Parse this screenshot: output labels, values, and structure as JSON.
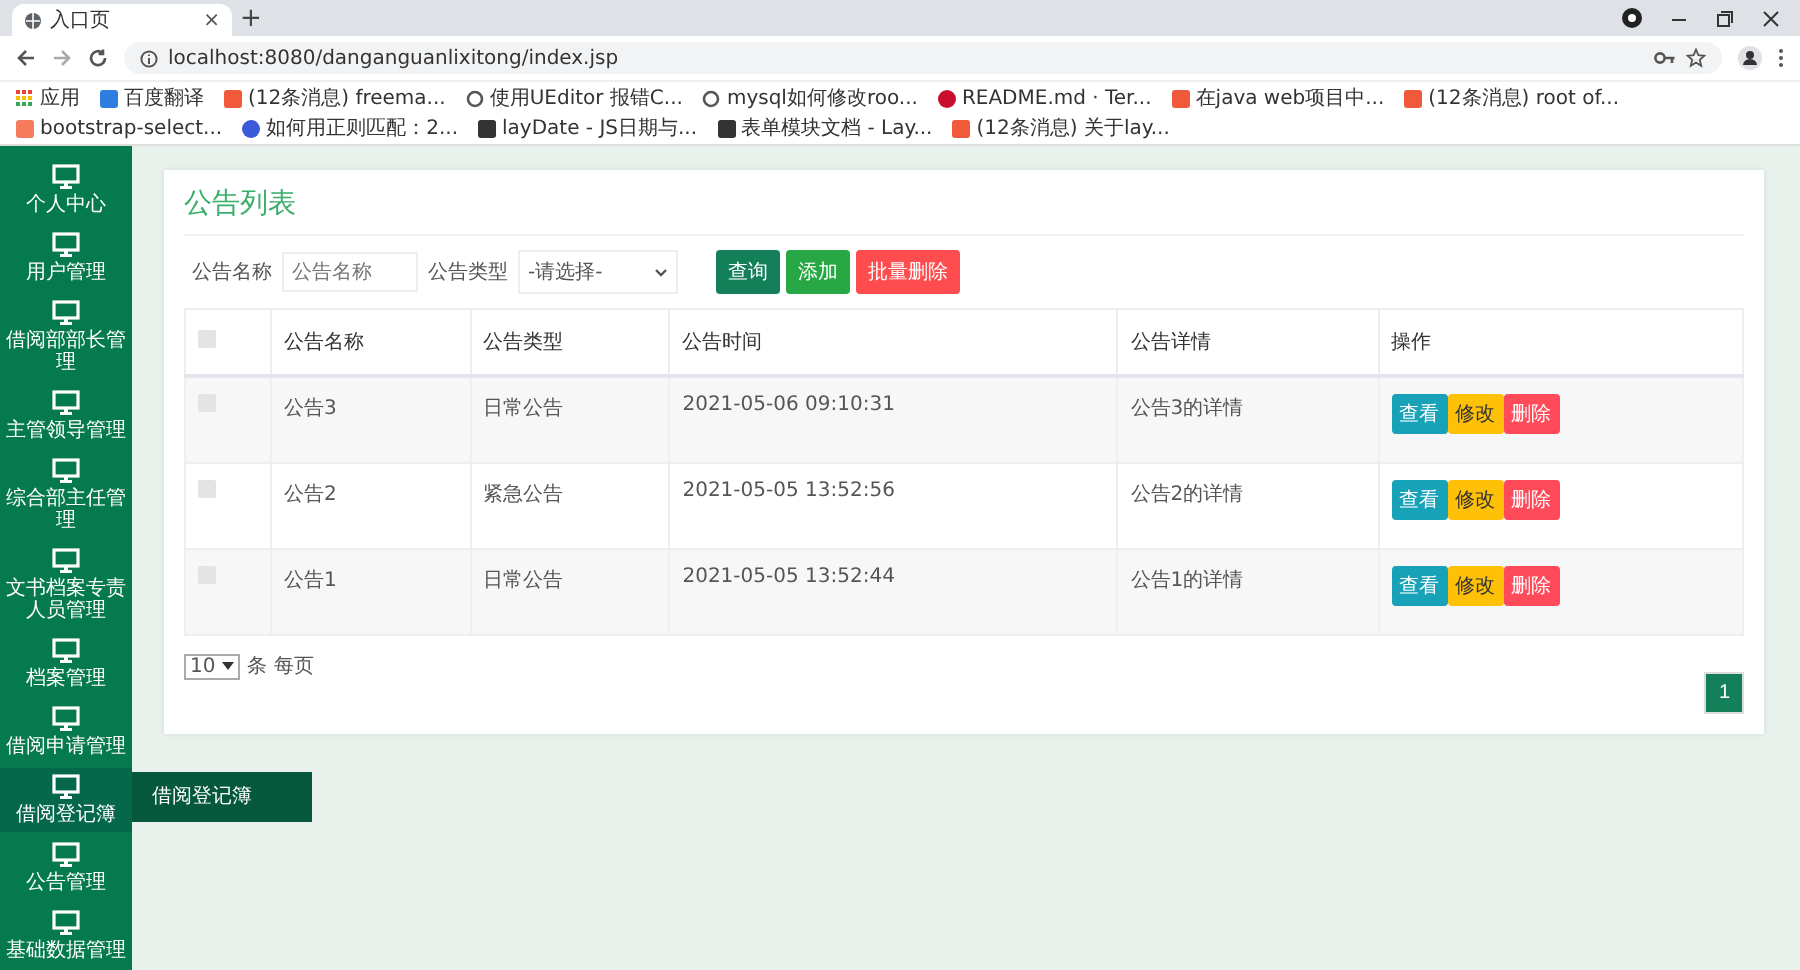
{
  "browser": {
    "tab": {
      "title": "入口页",
      "close": "×"
    },
    "new_tab": "+",
    "url": "localhost:8080/danganguanlixitong/index.jsp",
    "bookmarks": [
      {
        "kind": "apps",
        "label": "应用"
      },
      {
        "kind": "site",
        "color": "#2e7de1",
        "label": "百度翻译"
      },
      {
        "kind": "site",
        "color": "#f05a3a",
        "label": "(12条消息) freema..."
      },
      {
        "kind": "outline",
        "color": "#555555",
        "label": "使用UEditor 报错C..."
      },
      {
        "kind": "outline",
        "color": "#555555",
        "label": "mysql如何修改roo..."
      },
      {
        "kind": "round",
        "color": "#c8102e",
        "label": "README.md · Ter..."
      },
      {
        "kind": "site",
        "color": "#f05a3a",
        "label": "在java web项目中..."
      },
      {
        "kind": "site",
        "color": "#f05a3a",
        "label": "(12条消息) root of..."
      },
      {
        "kind": "site",
        "color": "#f47c5c",
        "label": "bootstrap-select..."
      },
      {
        "kind": "round",
        "color": "#3b5ad9",
        "label": "如何用正则匹配：2..."
      },
      {
        "kind": "site",
        "color": "#333333",
        "label": "layDate - JS日期与..."
      },
      {
        "kind": "site",
        "color": "#333333",
        "label": "表单模块文档 - Lay..."
      },
      {
        "kind": "site",
        "color": "#f05a3a",
        "label": "(12条消息) 关于lay..."
      }
    ]
  },
  "sidebar": {
    "items": [
      {
        "label": "个人中心",
        "hovered": false
      },
      {
        "label": "用户管理",
        "hovered": false
      },
      {
        "label": "借阅部部长管理",
        "hovered": false
      },
      {
        "label": "主管领导管理",
        "hovered": false
      },
      {
        "label": "综合部主任管理",
        "hovered": false
      },
      {
        "label": "文书档案专责人员管理",
        "hovered": false
      },
      {
        "label": "档案管理",
        "hovered": false
      },
      {
        "label": "借阅申请管理",
        "hovered": false
      },
      {
        "label": "借阅登记簿",
        "hovered": true,
        "tooltip": "借阅登记簿"
      },
      {
        "label": "公告管理",
        "hovered": false
      },
      {
        "label": "基础数据管理",
        "hovered": false
      }
    ]
  },
  "panel": {
    "title": "公告列表",
    "filters": [
      {
        "kind": "input",
        "label": "公告名称",
        "placeholder": "公告名称"
      },
      {
        "kind": "select",
        "label": "公告类型",
        "value": "-请选择-"
      }
    ],
    "buttons": [
      {
        "label": "查询",
        "color": "#13805a"
      },
      {
        "label": "添加",
        "color": "#28a745"
      },
      {
        "label": "批量删除",
        "color": "#ff4d4f"
      }
    ],
    "table": {
      "select_all": {
        "checked": false
      },
      "columns": [
        "公告名称",
        "公告类型",
        "公告时间",
        "公告详情",
        "操作"
      ],
      "rows": [
        {
          "checked": false,
          "cells": [
            "公告3",
            "日常公告",
            "2021-05-06 09:10:31",
            "公告3的详情"
          ],
          "actions": [
            "查看",
            "修改",
            "删除"
          ]
        },
        {
          "checked": false,
          "cells": [
            "公告2",
            "紧急公告",
            "2021-05-05 13:52:56",
            "公告2的详情"
          ],
          "actions": [
            "查看",
            "修改",
            "删除"
          ]
        },
        {
          "checked": false,
          "cells": [
            "公告1",
            "日常公告",
            "2021-05-05 13:52:44",
            "公告1的详情"
          ],
          "actions": [
            "查看",
            "修改",
            "删除"
          ]
        }
      ]
    },
    "page_size": "10",
    "page_size_label": "条 每页",
    "pages": [
      {
        "label": "1",
        "selected": true
      }
    ]
  }
}
